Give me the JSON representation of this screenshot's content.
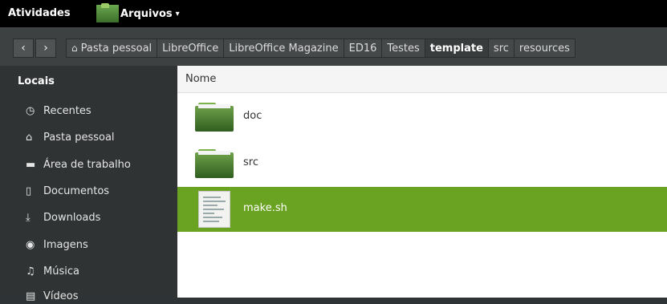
{
  "topbar": {
    "activities": "Atividades",
    "app_name": "Arquivos",
    "app_caret": "▾"
  },
  "nav": {
    "back": "‹",
    "forward": "›"
  },
  "breadcrumbs": [
    {
      "label": "Pasta pessoal",
      "icon": "home-icon"
    },
    {
      "label": "LibreOffice"
    },
    {
      "label": "LibreOffice Magazine"
    },
    {
      "label": "ED16"
    },
    {
      "label": "Testes"
    },
    {
      "label": "template"
    },
    {
      "label": "src"
    },
    {
      "label": "resources"
    }
  ],
  "sidebar": {
    "heading": "Locais",
    "items": [
      {
        "label": "Recentes",
        "icon": "clock-icon",
        "glyph": "◷"
      },
      {
        "label": "Pasta pessoal",
        "icon": "home-icon",
        "glyph": "⌂"
      },
      {
        "label": "Área de trabalho",
        "icon": "desktop-folder-icon",
        "glyph": "▬"
      },
      {
        "label": "Documentos",
        "icon": "document-icon",
        "glyph": "▯"
      },
      {
        "label": "Downloads",
        "icon": "download-icon",
        "glyph": "⤓"
      },
      {
        "label": "Imagens",
        "icon": "camera-icon",
        "glyph": "◉"
      },
      {
        "label": "Música",
        "icon": "music-icon",
        "glyph": "♫"
      },
      {
        "label": "Vídeos",
        "icon": "video-icon",
        "glyph": "▤"
      }
    ]
  },
  "main": {
    "column_name": "Nome",
    "files": [
      {
        "name": "doc",
        "type": "folder"
      },
      {
        "name": "src",
        "type": "folder"
      },
      {
        "name": "make.sh",
        "type": "script",
        "selected": true
      }
    ]
  },
  "colors": {
    "selection": "#6aa222",
    "sidebar": "#2f3334",
    "topbar": "#000000"
  }
}
